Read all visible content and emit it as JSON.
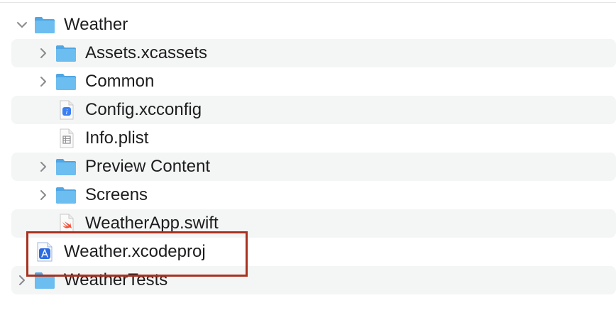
{
  "tree": {
    "items": [
      {
        "label": "Weather",
        "icon": "folder-icon",
        "expanded": true
      },
      {
        "label": "Assets.xcassets",
        "icon": "folder-icon",
        "expanded": false
      },
      {
        "label": "Common",
        "icon": "folder-icon",
        "expanded": false
      },
      {
        "label": "Config.xcconfig",
        "icon": "xcconfig-file-icon"
      },
      {
        "label": "Info.plist",
        "icon": "plist-file-icon"
      },
      {
        "label": "Preview Content",
        "icon": "folder-icon",
        "expanded": false
      },
      {
        "label": "Screens",
        "icon": "folder-icon",
        "expanded": false
      },
      {
        "label": "WeatherApp.swift",
        "icon": "swift-file-icon"
      },
      {
        "label": "Weather.xcodeproj",
        "icon": "xcodeproj-icon"
      },
      {
        "label": "WeatherTests",
        "icon": "folder-icon",
        "expanded": false
      }
    ]
  },
  "colors": {
    "folder": "#5fb3ea",
    "row_alt_bg": "#f4f5f5",
    "highlight_border": "#a8321f",
    "text": "#1d1d1f"
  }
}
